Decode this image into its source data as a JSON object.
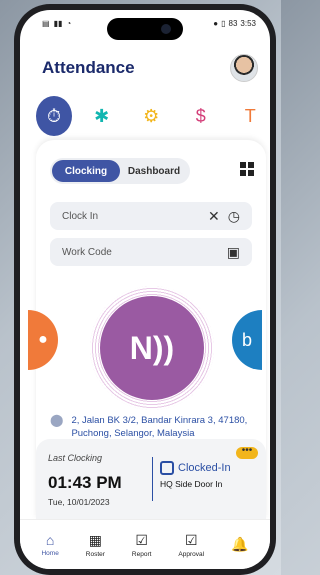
{
  "status_bar": {
    "time": "3:53",
    "battery": "83"
  },
  "header": {
    "title": "Attendance"
  },
  "menu": [
    {
      "icon": "clock-icon",
      "glyph": "⏱",
      "color": "#ffffff"
    },
    {
      "icon": "palm-tree-icon",
      "glyph": "🌴",
      "color": "#12b6b0"
    },
    {
      "icon": "gear-money-icon",
      "glyph": "⚙",
      "color": "#f2b51b"
    },
    {
      "icon": "user-money-icon",
      "glyph": "$",
      "color": "#d33d78"
    },
    {
      "icon": "key-icon",
      "glyph": "🔑",
      "color": "#f07a3a"
    }
  ],
  "tabs": {
    "clocking": "Clocking",
    "dashboard": "Dashboard"
  },
  "clock_in": {
    "label": "Clock In"
  },
  "work_code": {
    "label": "Work Code"
  },
  "address": "2, Jalan BK 3/2, Bandar Kinrara 3, 47180, Puchong, Selangor, Malaysia",
  "last_clocking": {
    "label": "Last Clocking",
    "time": "01:43 PM",
    "date": "Tue, 10/01/2023",
    "status": "Clocked-In",
    "location": "HQ Side Door In"
  },
  "nav": [
    {
      "label": "Home",
      "icon": "home-icon",
      "glyph": "⌂"
    },
    {
      "label": "Roster",
      "icon": "calendar-icon",
      "glyph": "▦"
    },
    {
      "label": "Report",
      "icon": "report-icon",
      "glyph": "☑"
    },
    {
      "label": "Approval",
      "icon": "approval-icon",
      "glyph": "☑"
    },
    {
      "label": "",
      "icon": "bell-icon",
      "glyph": "🔔"
    }
  ]
}
